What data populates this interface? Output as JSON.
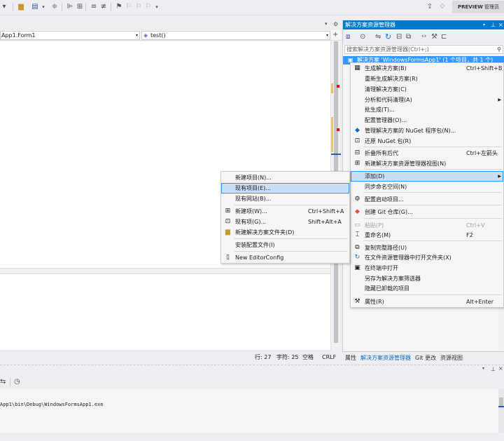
{
  "toolbar": {
    "preview_label": "PREVIEW",
    "manage_label": "管理员"
  },
  "editor": {
    "class_dropdown": "App1.Form1",
    "method_dropdown": "test()"
  },
  "solution_explorer": {
    "title": "解决方案资源管理器",
    "search_placeholder": "搜索解决方案资源管理器(Ctrl+;)",
    "solution_item": "解决方案 'WindowsFormsApp1' (1 个项目，共 1 个)"
  },
  "context_menu": {
    "items": [
      {
        "label": "生成解决方案(B)",
        "shortcut": "Ctrl+Shift+B",
        "icon": "build-icon"
      },
      {
        "label": "重新生成解决方案(R)",
        "shortcut": "",
        "icon": ""
      },
      {
        "label": "清理解决方案(C)",
        "shortcut": "",
        "icon": ""
      },
      {
        "label": "分析和代码清理(A)",
        "shortcut": "",
        "icon": "",
        "submenu": true
      },
      {
        "label": "批生成(T)...",
        "shortcut": "",
        "icon": ""
      },
      {
        "label": "配置管理器(O)...",
        "shortcut": "",
        "icon": ""
      },
      {
        "label": "管理解决方案的 NuGet 程序包(N)...",
        "shortcut": "",
        "icon": "nuget-icon"
      },
      {
        "label": "还原 NuGet 包(R)",
        "shortcut": "",
        "icon": "restore-icon"
      },
      {
        "label": "折叠所有后代",
        "shortcut": "Ctrl+左箭头",
        "icon": "collapse-icon"
      },
      {
        "label": "新建解决方案资源管理器视图(N)",
        "shortcut": "",
        "icon": "new-view-icon"
      },
      {
        "label": "添加(D)",
        "shortcut": "",
        "icon": "",
        "submenu": true,
        "highlighted": true
      },
      {
        "label": "同步命名空间(N)",
        "shortcut": "",
        "icon": ""
      },
      {
        "label": "配置启动项目...",
        "shortcut": "",
        "icon": "gear-icon"
      },
      {
        "label": "创建 Git 仓库(G)...",
        "shortcut": "",
        "icon": "git-icon"
      },
      {
        "label": "粘贴(P)",
        "shortcut": "Ctrl+V",
        "icon": "paste-icon",
        "disabled": true
      },
      {
        "label": "重命名(M)",
        "shortcut": "F2",
        "icon": "rename-icon"
      },
      {
        "label": "复制完整路径(U)",
        "shortcut": "",
        "icon": "copy-icon"
      },
      {
        "label": "在文件资源管理器中打开文件夹(X)",
        "shortcut": "",
        "icon": "refresh-icon"
      },
      {
        "label": "在终端中打开",
        "shortcut": "",
        "icon": "terminal-icon"
      },
      {
        "label": "另存为解决方案筛选器",
        "shortcut": "",
        "icon": ""
      },
      {
        "label": "隐藏已卸载的项目",
        "shortcut": "",
        "icon": ""
      },
      {
        "label": "属性(R)",
        "shortcut": "Alt+Enter",
        "icon": "wrench-icon"
      }
    ]
  },
  "add_submenu": {
    "items": [
      {
        "label": "新建项目(N)...",
        "shortcut": "",
        "icon": ""
      },
      {
        "label": "现有项目(E)...",
        "shortcut": "",
        "icon": "",
        "highlighted": true
      },
      {
        "label": "现有网站(B)...",
        "shortcut": "",
        "icon": ""
      },
      {
        "label": "新建项(W)...",
        "shortcut": "Ctrl+Shift+A",
        "icon": "new-item-icon"
      },
      {
        "label": "现有项(G)...",
        "shortcut": "Shift+Alt+A",
        "icon": "existing-item-icon"
      },
      {
        "label": "新建解决方案文件夹(D)",
        "shortcut": "",
        "icon": "folder-icon"
      },
      {
        "label": "安装配置文件(I)",
        "shortcut": "",
        "icon": ""
      },
      {
        "label": "New EditorConfig",
        "shortcut": "",
        "icon": "editorconfig-icon"
      }
    ]
  },
  "status": {
    "line": "行: 27",
    "char": "字符: 25",
    "space": "空格",
    "eol": "CRLF"
  },
  "bottom_tabs": [
    "属性",
    "解决方案资源管理器",
    "Git 更改",
    "资源视图"
  ],
  "output": {
    "text": "App1\\bin\\Debug\\WindowsFormsApp1.exe"
  }
}
